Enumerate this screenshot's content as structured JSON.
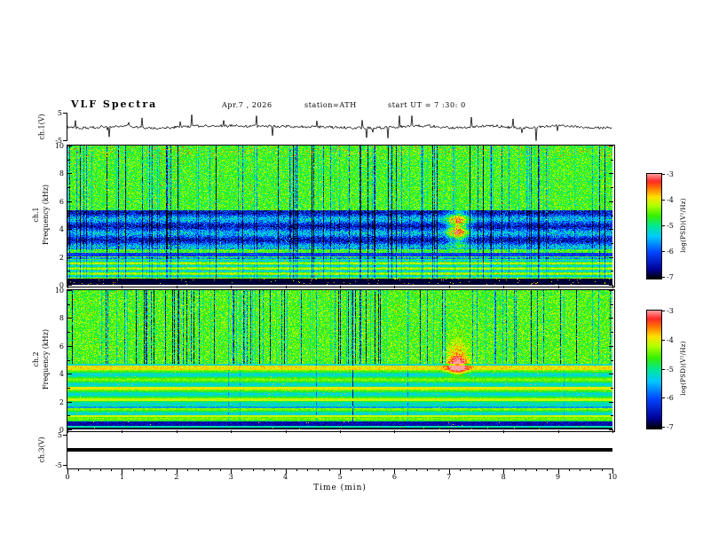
{
  "header": {
    "title": "VLF  Spectra",
    "date": "Apr.7 , 2026",
    "station": "station=ATH",
    "start_ut": "start UT =  7 :30: 0"
  },
  "chart_data": {
    "type": "heatmap",
    "title": "VLF Spectra",
    "xlabel": "Time  (min)",
    "xlim": [
      0,
      10
    ],
    "xticks": [
      "0",
      "1",
      "2",
      "3",
      "4",
      "5",
      "6",
      "7",
      "8",
      "9",
      "10"
    ],
    "panels": [
      {
        "id": "ch1_waveform",
        "type": "line",
        "ylabel": "ch.1(V)",
        "ylim": [
          -5,
          5
        ],
        "yticks": [
          "5",
          "-5"
        ],
        "description": "Broadband noisy voltage trace centered on 0 V with dense impulsive spikes reaching about ±4 V"
      },
      {
        "id": "ch1_spectrogram",
        "type": "heatmap",
        "channel_label": "ch.1",
        "ylabel": "Frequency (kHz)",
        "ylim": [
          0,
          10
        ],
        "yticks": [
          "10",
          "8",
          "6",
          "4",
          "2",
          "0"
        ],
        "features": {
          "background_psd": -4.6,
          "vertical_sferic_stripes": "dense full-height low-PSD (blue) impulsive columns with scattered high-PSD (red) speckles above ~6 kHz",
          "dark_band_khz": [
            2.6,
            5.4
          ],
          "dark_band_psd": -6.2,
          "narrow_lines_khz": [
            1.9,
            2.2
          ],
          "bottom_cutoff_khz": 0.5,
          "bottom_psd": -7,
          "event_time_min": 7.15,
          "event_khz": [
            3.0,
            5.5
          ],
          "event_psd": -4.3
        }
      },
      {
        "id": "ch2_spectrogram",
        "type": "heatmap",
        "channel_label": "ch.2",
        "ylabel": "Frequency (kHz)",
        "ylim": [
          0,
          10
        ],
        "yticks": [
          "10",
          "8",
          "6",
          "4",
          "2",
          "0"
        ],
        "features": {
          "background_psd": -4.7,
          "vertical_sferic_stripes": "dense low-PSD (blue) columns mainly above ~4.8 kHz",
          "line_khz": 4.5,
          "line_psd": -3.9,
          "horizontal_lines_khz": [
            1.0,
            1.6,
            2.2,
            3.0
          ],
          "dark_band_khz": [
            0.3,
            0.6
          ],
          "event_time_min": 7.15,
          "event_khz": 4.5,
          "event_psd": -3.3
        }
      },
      {
        "id": "ch3_waveform",
        "type": "line",
        "ylabel": "ch.3(V)",
        "ylim": [
          -5,
          5
        ],
        "yticks": [
          "5",
          "-5"
        ],
        "description": "Flat thick line at 0 V (channel inactive)",
        "values_constant": 0
      }
    ],
    "colorbar": {
      "label": "log(PSD)(V²/Hz)",
      "ticks": [
        "-3",
        "-4",
        "-5",
        "-6",
        "-7"
      ],
      "range": [
        -7,
        -3
      ],
      "colormap": [
        [
          0.0,
          "#000000"
        ],
        [
          0.09,
          "#00009a"
        ],
        [
          0.25,
          "#0044ff"
        ],
        [
          0.4,
          "#00c8ff"
        ],
        [
          0.5,
          "#00e896"
        ],
        [
          0.6,
          "#36f000"
        ],
        [
          0.7,
          "#b4ff00"
        ],
        [
          0.78,
          "#ffe000"
        ],
        [
          0.86,
          "#ff7800"
        ],
        [
          0.93,
          "#ff2828"
        ],
        [
          1.0,
          "#ff9e9e"
        ]
      ]
    }
  }
}
